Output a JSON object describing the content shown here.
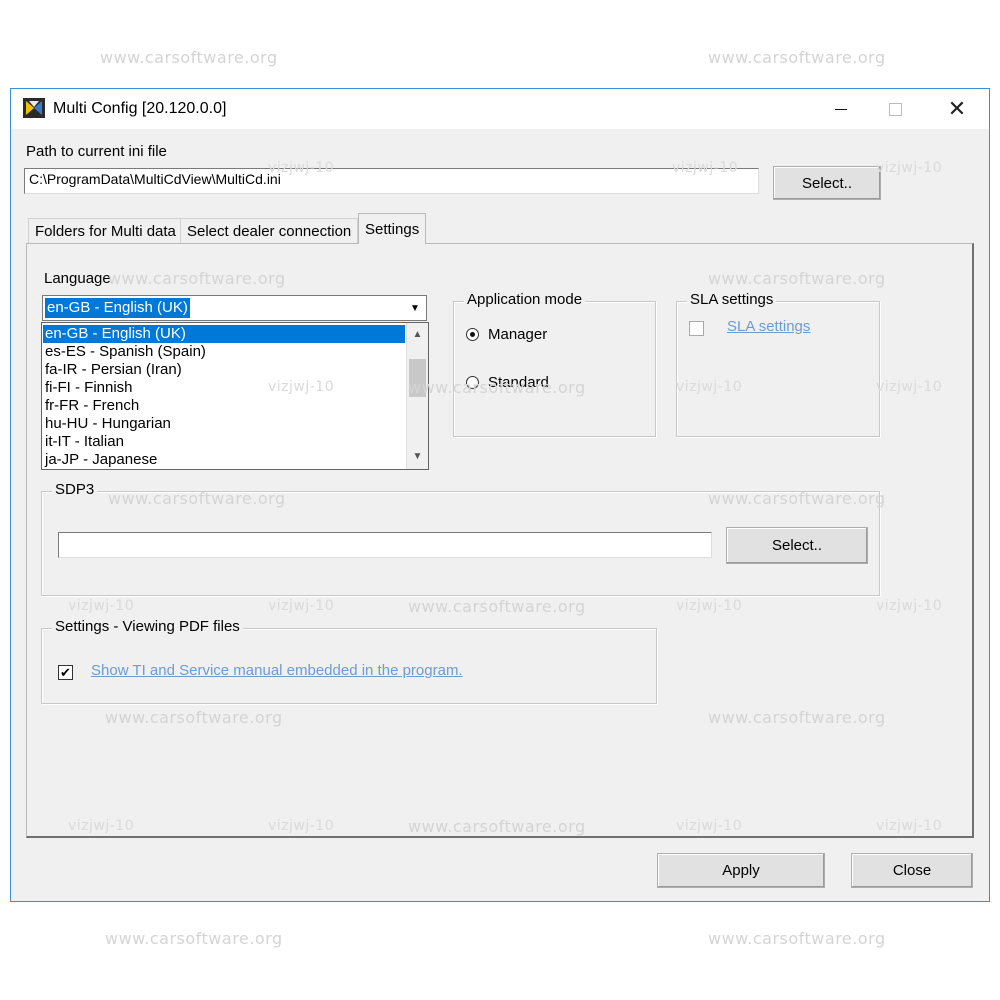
{
  "watermark": {
    "site": "www.carsoftware.org",
    "code": "vizjwj-10"
  },
  "window": {
    "title": "Multi Config [20.120.0.0]",
    "minimize_icon": "minimize-icon",
    "maximize_icon": "maximize-icon",
    "close_symbol": "✕"
  },
  "ini_path": {
    "label": "Path to current ini file",
    "value": "C:\\ProgramData\\MultiCdView\\MultiCd.ini",
    "select_label": "Select.."
  },
  "tabs": [
    "Folders for Multi data",
    "Select dealer connection",
    "Settings"
  ],
  "active_tab": "Settings",
  "language": {
    "label": "Language",
    "selected": "en-GB - English (UK)",
    "options": [
      "en-GB - English (UK)",
      "es-ES - Spanish (Spain)",
      "fa-IR - Persian (Iran)",
      "fi-FI - Finnish",
      "fr-FR - French",
      "hu-HU - Hungarian",
      "it-IT - Italian",
      "ja-JP - Japanese"
    ]
  },
  "application_mode": {
    "title": "Application mode",
    "options": [
      "Manager",
      "Standard"
    ],
    "selected": "Manager"
  },
  "sla": {
    "title": "SLA settings",
    "checkbox_label": "SLA settings",
    "checked": false,
    "enabled": false
  },
  "sdp3": {
    "title": "SDP3",
    "value": "",
    "select_label": "Select.."
  },
  "pdf": {
    "title": "Settings - Viewing PDF files",
    "checkbox_label": "Show TI and Service manual embedded in the program.",
    "checked": true
  },
  "footer": {
    "apply_label": "Apply",
    "close_label": "Close"
  },
  "colors": {
    "selection": "#0078d7",
    "link": "#6c9bd6",
    "window_border": "#3b8fd6",
    "face": "#f0f0f0"
  }
}
